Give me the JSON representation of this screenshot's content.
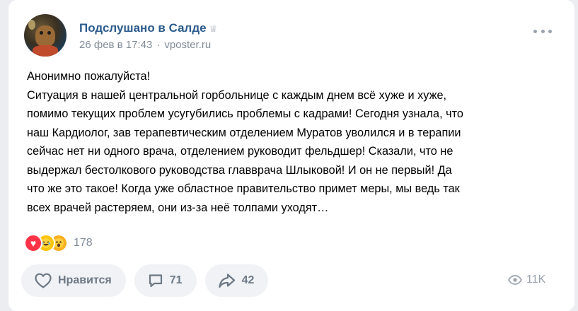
{
  "post": {
    "community_name": "Подслушано в Салде",
    "date": "26 фев в 17:43",
    "separator": "·",
    "source": "vposter.ru",
    "text_lines": [
      "Анонимно пожалуйста!",
      "Ситуация в нашей центральной горбольнице с каждым днем всё хуже и хуже,",
      "помимо текущих проблем усугубились проблемы с кадрами! Сегодня узнала, что",
      "наш Кардиолог, зав терапевтическим отделением Муратов уволился и в терапии",
      "сейчас нет ни одного врача, отделением руководит фельдшер! Сказали, что не",
      "выдержал бестолкового руководства главврача Шлыковой! И он не первый! Да",
      "что же это такое! Когда уже областное правительство примет меры, мы ведь так",
      "всех врачей растеряем, они из-за неё толпами уходят…"
    ]
  },
  "reactions": {
    "count": "178",
    "icons": [
      "heart-reaction",
      "laugh-reaction",
      "wow-reaction"
    ]
  },
  "actions": {
    "like_label": "Нравится",
    "comments_count": "71",
    "shares_count": "42",
    "views_count": "11K"
  },
  "colors": {
    "link": "#2b5b8c",
    "secondary": "#818c99",
    "button_bg": "#f0f2f5",
    "reaction_heart": "#ff3347"
  }
}
